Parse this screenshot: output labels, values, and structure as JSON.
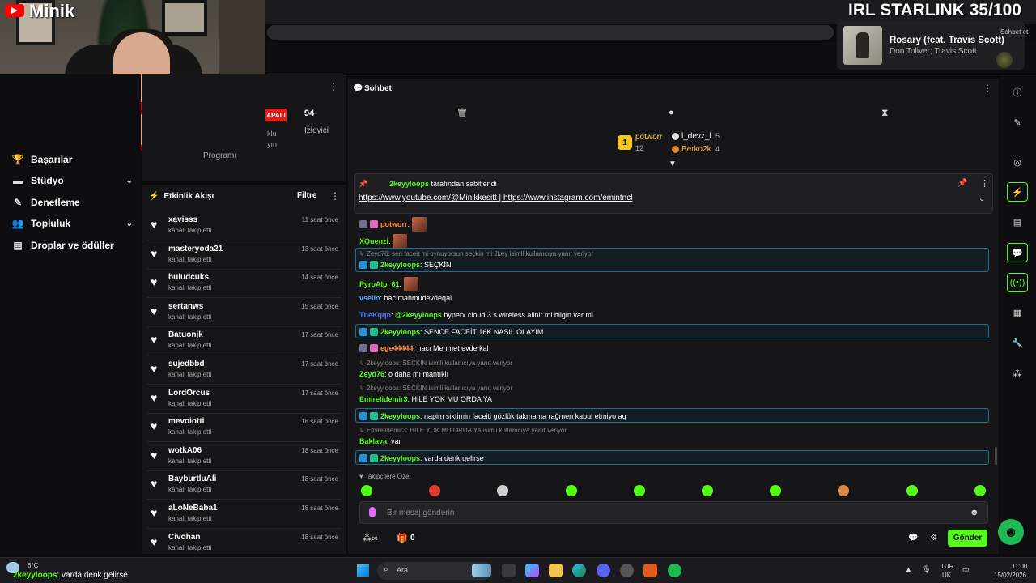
{
  "overlay": {
    "channel": "Minik",
    "title": "IRL STARLINK 35/100",
    "mini_chat": "Sohbet et"
  },
  "music": {
    "title": "Rosary (feat. Travis Scott)",
    "artist": "Don Toliver; Travis Scott"
  },
  "sidebar": {
    "items": [
      {
        "icon": "trophy-icon",
        "glyph": "🏆",
        "label": "Başarılar",
        "chevron": false
      },
      {
        "icon": "studio-icon",
        "glyph": "▬",
        "label": "Stüdyo",
        "chevron": true
      },
      {
        "icon": "moderation-icon",
        "glyph": "✎",
        "label": "Denetleme",
        "chevron": false
      },
      {
        "icon": "community-icon",
        "glyph": "👥",
        "label": "Topluluk",
        "chevron": true
      },
      {
        "icon": "drops-icon",
        "glyph": "▤",
        "label": "Droplar ve ödüller",
        "chevron": false
      }
    ]
  },
  "stats": {
    "status": "APALI",
    "viewers": "94",
    "viewers_label": "İzleyici",
    "fragment1": "klu",
    "fragment2": "yın",
    "fragment3": "Programı"
  },
  "activity": {
    "title": "Etkinlik Akışı",
    "filter": "Filtre",
    "items": [
      {
        "name": "xavisss",
        "action": "kanalı takip etti",
        "time": "11 saat önce"
      },
      {
        "name": "masteryoda21",
        "action": "kanalı takip etti",
        "time": "13 saat önce"
      },
      {
        "name": "buludcuks",
        "action": "kanalı takip etti",
        "time": "14 saat önce"
      },
      {
        "name": "sertanws",
        "action": "kanalı takip etti",
        "time": "15 saat önce"
      },
      {
        "name": "Batuonjk",
        "action": "kanalı takip etti",
        "time": "17 saat önce"
      },
      {
        "name": "sujedbbd",
        "action": "kanalı takip etti",
        "time": "17 saat önce"
      },
      {
        "name": "LordOrcus",
        "action": "kanalı takip etti",
        "time": "17 saat önce"
      },
      {
        "name": "mevoiotti",
        "action": "kanalı takip etti",
        "time": "18 saat önce"
      },
      {
        "name": "wotkA06",
        "action": "kanalı takip etti",
        "time": "18 saat önce"
      },
      {
        "name": "BayburtluAli",
        "action": "kanalı takip etti",
        "time": "18 saat önce"
      },
      {
        "name": "aLoNeBaba1",
        "action": "kanalı takip etti",
        "time": "18 saat önce"
      },
      {
        "name": "Civohan",
        "action": "kanalı takip etti",
        "time": "18 saat önce"
      }
    ]
  },
  "chat": {
    "title": "Sohbet",
    "leaders": [
      {
        "name": "potworr",
        "count": "12"
      },
      {
        "name": "l_devz_l",
        "count": "5"
      },
      {
        "name": "Berko2k",
        "count": "4"
      }
    ],
    "pinned": {
      "user": "2keyyloops",
      "by_text": "tarafından sabitlendi",
      "link1": "https://www.youtube.com/@Minikkesitt",
      "separator": " | ",
      "link2": "https://www.instagram.com/emintncl"
    },
    "messages": [
      {
        "user": "potworr",
        "text": ":"
      },
      {
        "user": "XQuenzi",
        "text": ":"
      },
      {
        "reply": "Zeyd76: sen faceit mi oynuyorsun seçkin mi 2key isimli kullanıcıya yanıt veriyor",
        "user": "2keyyloops",
        "text": ": SEÇKİN"
      },
      {
        "user": "PyroAlp_61",
        "text": ":"
      },
      {
        "user": "vselin",
        "text": ": hacımahmudevdeqal"
      },
      {
        "user": "TheKqqn",
        "mention": "@2keyyloops",
        "text": " hyperx cloud 3 s wireless alinir mi bilgin var mi"
      },
      {
        "user": "2keyyloops",
        "text": ": SENCE FACEİT 16K NASIL OLAYIM"
      },
      {
        "user": "ege44444",
        "text": ": hacı Mehmet evde kal"
      },
      {
        "reply": "2keyyloops: SEÇKİN isimli kullanıcıya yanıt veriyor",
        "user": "Zeyd76",
        "text": ": o daha mı mantıklı"
      },
      {
        "reply": "2keyyloops: SEÇKİN isimli kullanıcıya yanıt veriyor",
        "user": "Emirelidemir3",
        "text": ": HILE YOK MU ORDA YA"
      },
      {
        "user": "2keyyloops",
        "text": ": napim siktimin faceiti gözlük takmama rağmen kabul etmiyo aq"
      },
      {
        "reply": "Emirelidemir3: HILE YOK MU ORDA YA isimli kullanıcıya yanıt veriyor",
        "user": "Baklava",
        "text": ": var"
      },
      {
        "user": "2keyyloops",
        "text": ": varda denk gelirse"
      }
    ],
    "followers_only": "Takipçilere Özel",
    "input_placeholder": "Bir mesaj gönderin",
    "gift_count": "0",
    "send_label": "Gönder"
  },
  "taskbar": {
    "temp": "6°C",
    "ticker_user": "2keyyloops",
    "ticker_text": ": varda denk gelirse",
    "search": "Ara",
    "lang1": "TUR",
    "lang2": "UK",
    "time": "11:00",
    "date": "15/02/2026"
  },
  "colors": {
    "kick_green": "#53fc18",
    "live_red": "#e91916",
    "highlight_border": "#1e6f8f"
  }
}
